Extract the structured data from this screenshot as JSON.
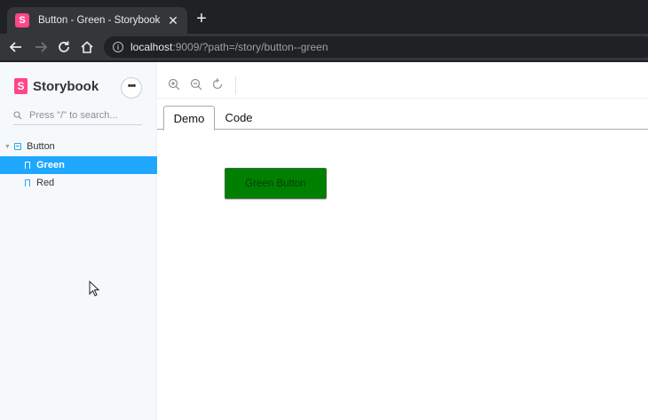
{
  "browser": {
    "tab_title": "Button - Green - Storybook",
    "favicon_letter": "S",
    "url_host": "localhost",
    "url_rest": ":9009/?path=/story/button--green"
  },
  "sidebar": {
    "brand_letter": "S",
    "brand_name": "Storybook",
    "menu_label": "•••",
    "search_placeholder": "Press \"/\" to search...",
    "component": "Button",
    "stories": [
      "Green",
      "Red"
    ],
    "selected_story": "Green"
  },
  "preview": {
    "tabs": [
      "Demo",
      "Code"
    ],
    "active_tab": "Demo",
    "button_label": "Green Button",
    "button_color": "#008000"
  },
  "colors": {
    "accent": "#1ea7fd",
    "brand": "#ff4785"
  }
}
